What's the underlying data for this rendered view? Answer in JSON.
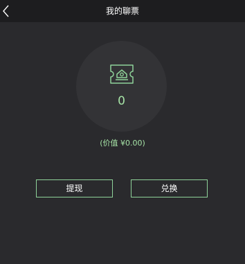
{
  "header": {
    "title": "我的聊票",
    "back_icon": "chevron-left-icon"
  },
  "ticket": {
    "icon": "ticket-icon",
    "count": "0",
    "value_text": "(价值 ¥0.00)"
  },
  "actions": {
    "withdraw_label": "提现",
    "exchange_label": "兑换"
  },
  "colors": {
    "background": "#2a2a2d",
    "header_bg": "#1d1d1f",
    "accent": "#8fd39a",
    "circle_bg": "#333336"
  }
}
